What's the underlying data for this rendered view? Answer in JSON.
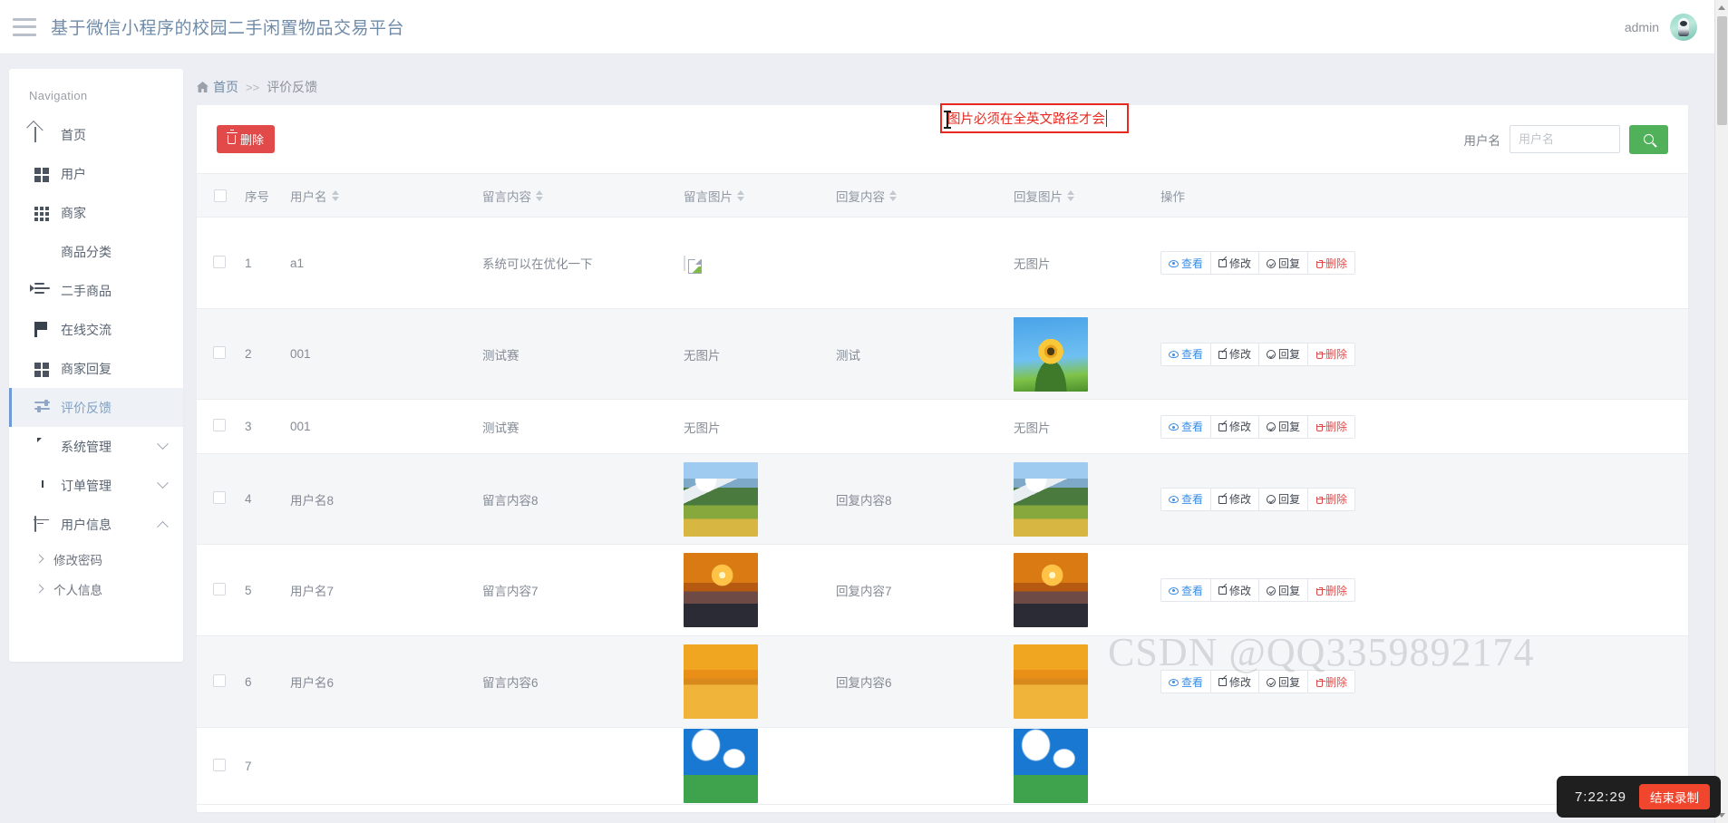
{
  "header": {
    "menu_icon": "hamburger-icon",
    "title": "基于微信小程序的校园二手闲置物品交易平台",
    "username": "admin",
    "avatar": "user-avatar"
  },
  "sidebar": {
    "nav_title": "Navigation",
    "items": [
      {
        "label": "首页",
        "icon": "home-icon",
        "active": false,
        "expandable": false
      },
      {
        "label": "用户",
        "icon": "grid-icon",
        "active": false,
        "expandable": false
      },
      {
        "label": "商家",
        "icon": "apps-icon",
        "active": false,
        "expandable": false
      },
      {
        "label": "商品分类",
        "icon": "shop-icon",
        "active": false,
        "expandable": false
      },
      {
        "label": "二手商品",
        "icon": "list-icon",
        "active": false,
        "expandable": false
      },
      {
        "label": "在线交流",
        "icon": "flag-icon",
        "active": false,
        "expandable": false
      },
      {
        "label": "商家回复",
        "icon": "grid-icon",
        "active": false,
        "expandable": false
      },
      {
        "label": "评价反馈",
        "icon": "sliders-icon",
        "active": true,
        "expandable": false
      },
      {
        "label": "系统管理",
        "icon": "chat-icon",
        "active": false,
        "expandable": true,
        "expanded": false
      },
      {
        "label": "订单管理",
        "icon": "ticket-icon",
        "active": false,
        "expandable": true,
        "expanded": false
      },
      {
        "label": "用户信息",
        "icon": "card-icon",
        "active": false,
        "expandable": true,
        "expanded": true
      }
    ],
    "sub_items": [
      {
        "label": "修改密码",
        "icon": "chevron-right-icon"
      },
      {
        "label": "个人信息",
        "icon": "chevron-right-icon"
      }
    ]
  },
  "breadcrumb": {
    "home": "首页",
    "separator": ">>",
    "current": "评价反馈"
  },
  "toolbar": {
    "delete_label": "删除",
    "delete_icon": "trash-icon",
    "delete_color": "#e24a4a"
  },
  "validation": {
    "text": "图片必须在全英文路径才会",
    "border_color": "#e8291f",
    "text_color": "#e8291f"
  },
  "search": {
    "label": "用户名",
    "placeholder": "用户名",
    "value": "",
    "button_icon": "search-icon",
    "button_color": "#51b15b"
  },
  "table": {
    "columns": [
      {
        "key": "checkbox",
        "label": "",
        "sortable": false
      },
      {
        "key": "index",
        "label": "序号",
        "sortable": false
      },
      {
        "key": "username",
        "label": "用户名",
        "sortable": true
      },
      {
        "key": "message",
        "label": "留言内容",
        "sortable": true
      },
      {
        "key": "msg_img",
        "label": "留言图片",
        "sortable": true
      },
      {
        "key": "reply",
        "label": "回复内容",
        "sortable": true
      },
      {
        "key": "rep_img",
        "label": "回复图片",
        "sortable": true
      },
      {
        "key": "actions",
        "label": "操作",
        "sortable": false
      }
    ],
    "no_image_text": "无图片",
    "actions": [
      {
        "label": "查看",
        "icon": "eye-icon",
        "style": "view"
      },
      {
        "label": "修改",
        "icon": "edit-icon",
        "style": "edit"
      },
      {
        "label": "回复",
        "icon": "check-circle-icon",
        "style": "reply"
      },
      {
        "label": "删除",
        "icon": "trash-icon",
        "style": "del"
      }
    ],
    "rows": [
      {
        "index": "1",
        "username": "a1",
        "message": "系统可以在优化一下",
        "msg_img": "broken",
        "reply": "",
        "rep_img": "none"
      },
      {
        "index": "2",
        "username": "001",
        "message": "测试赛",
        "msg_img": "none",
        "reply": "测试",
        "rep_img": "flower"
      },
      {
        "index": "3",
        "username": "001",
        "message": "测试赛",
        "msg_img": "none",
        "reply": "",
        "rep_img": "none"
      },
      {
        "index": "4",
        "username": "用户名8",
        "message": "留言内容8",
        "msg_img": "mountain",
        "reply": "回复内容8",
        "rep_img": "mountain"
      },
      {
        "index": "5",
        "username": "用户名7",
        "message": "留言内容7",
        "msg_img": "sunset",
        "reply": "回复内容7",
        "rep_img": "sunset"
      },
      {
        "index": "6",
        "username": "用户名6",
        "message": "留言内容6",
        "msg_img": "goldlake",
        "reply": "回复内容6",
        "rep_img": "goldlake"
      },
      {
        "index": "7",
        "username": "",
        "message": "",
        "msg_img": "sky",
        "reply": "",
        "rep_img": "sky"
      }
    ]
  },
  "watermark": {
    "text": "CSDN @QQ3359892174"
  },
  "recorder": {
    "time": "7:22:29",
    "stop_label": "结束录制",
    "stop_color": "#f0462d"
  }
}
